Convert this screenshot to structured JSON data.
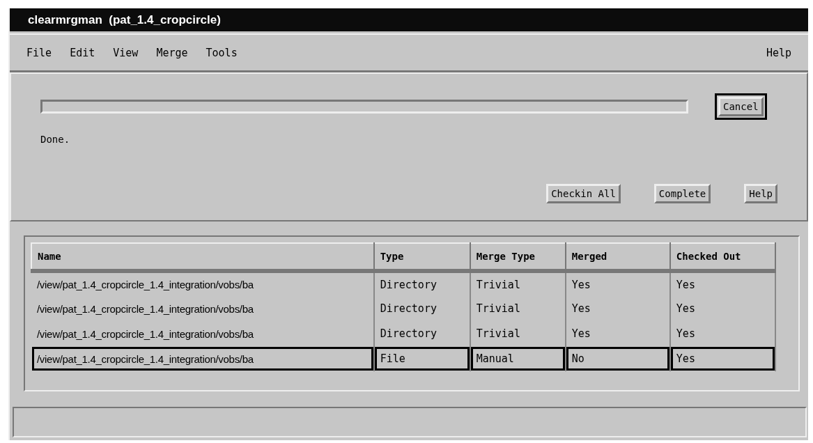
{
  "window": {
    "title": "clearmrgman  (pat_1.4_cropcircle)"
  },
  "menu": {
    "items": [
      "File",
      "Edit",
      "View",
      "Merge",
      "Tools"
    ],
    "help": "Help"
  },
  "progress": {
    "level": 0
  },
  "cancel_button": "Cancel",
  "status": "Done.",
  "buttons": [
    "Checkin All",
    "Complete",
    "Help"
  ],
  "table": {
    "columns": [
      "Name",
      "Type",
      "Merge Type",
      "Merged",
      "Checked Out"
    ],
    "rows": [
      {
        "cells": [
          "/view/pat_1.4_cropcircle_1.4_integration/vobs/ba",
          "Directory",
          "Trivial",
          "Yes",
          "Yes"
        ],
        "selected": false
      },
      {
        "cells": [
          "/view/pat_1.4_cropcircle_1.4_integration/vobs/ba",
          "Directory",
          "Trivial",
          "Yes",
          "Yes"
        ],
        "selected": false
      },
      {
        "cells": [
          "/view/pat_1.4_cropcircle_1.4_integration/vobs/ba",
          "Directory",
          "Trivial",
          "Yes",
          "Yes"
        ],
        "selected": false
      },
      {
        "cells": [
          "/view/pat_1.4_cropcircle_1.4_integration/vobs/ba",
          "File",
          "Manual",
          "No",
          "Yes"
        ],
        "selected": true
      }
    ]
  }
}
